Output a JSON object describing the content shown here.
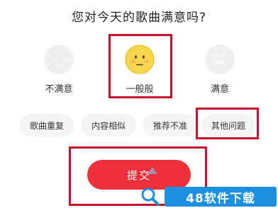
{
  "question": "您对今天的歌曲满意吗?",
  "ratings": [
    {
      "label": "不满意",
      "icon": "neutral-face-icon"
    },
    {
      "label": "一般般",
      "icon": "meh-face-icon"
    },
    {
      "label": "满意",
      "icon": "smile-face-icon"
    }
  ],
  "selected_rating": "一般般",
  "tags": [
    "歌曲重复",
    "内容相似",
    "推荐不准",
    "其他问题"
  ],
  "submit_label": "提交",
  "watermark": {
    "text": "48软件下载",
    "icon": "search-icon"
  },
  "colors": {
    "accent": "#ee2e38",
    "highlight": "#c8102e",
    "tag_bg": "#f4f4f4",
    "face_inactive": "#efefef",
    "face_selected": "#f7d54e",
    "watermark_blue": "#1b8fe0"
  }
}
